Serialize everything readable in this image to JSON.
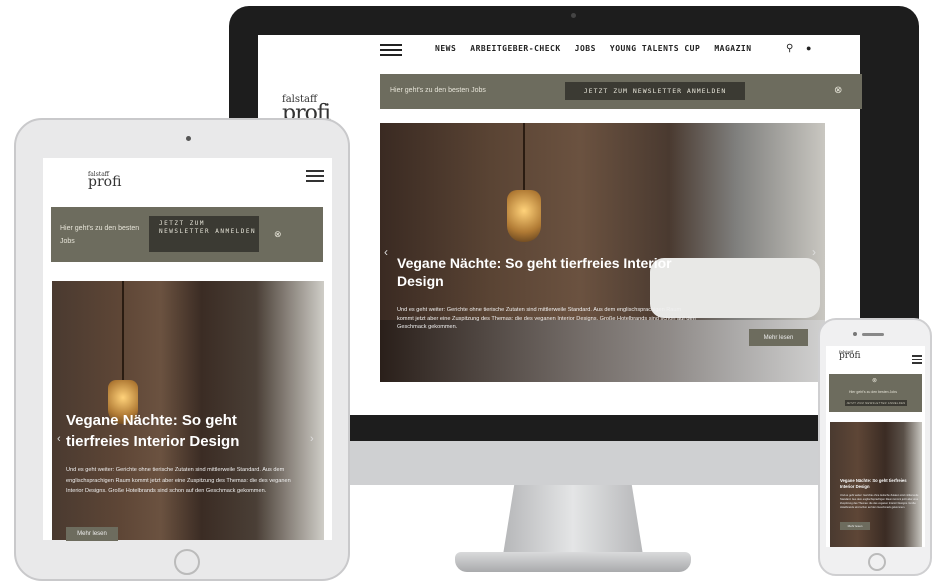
{
  "brand": {
    "logo_line1": "falstaff",
    "logo_line2": "profi"
  },
  "desktop": {
    "nav": [
      "NEWS",
      "ARBEITGEBER-CHECK",
      "JOBS",
      "YOUNG TALENTS CUP",
      "MAGAZIN"
    ],
    "search_icon": "⚲",
    "user_icon": "●",
    "band": {
      "text": "Hier geht's zu den besten Jobs",
      "button": "JETZT ZUM NEWSLETTER ANMELDEN",
      "close": "⊗"
    },
    "hero": {
      "title": "Vegane Nächte: So geht tierfreies Interior Design",
      "body": "Und es geht weiter: Gerichte ohne tierische Zutaten sind mittlerweile Standard. Aus dem englischsprachigen Raum kommt jetzt aber eine Zuspitzung des Themas: die des veganen Interior Designs. Große Hotelbrands sind schon auf den Geschmack gekommen.",
      "more": "Mehr lesen",
      "arrow_left": "‹",
      "arrow_right": "›"
    }
  },
  "tablet": {
    "band": {
      "text": "Hier geht's zu den besten Jobs",
      "button": "JETZT ZUM NEWSLETTER ANMELDEN",
      "close": "⊗"
    },
    "hero": {
      "title": "Vegane Nächte: So geht tierfreies Interior Design",
      "body": "Und es geht weiter: Gerichte ohne tierische Zutaten sind mittlerweile Standard. Aus dem englischsprachigen Raum kommt jetzt aber eine Zuspitzung des Themas: die des veganen Interior Designs. Große Hotelbrands sind schon auf den Geschmack gekommen.",
      "more": "Mehr lesen",
      "arrow_left": "‹",
      "arrow_right": "›"
    }
  },
  "phone": {
    "band": {
      "text": "Hier geht's zu den besten Jobs",
      "button": "JETZT ZUM NEWSLETTER ANMELDEN",
      "close": "⊗"
    },
    "hero": {
      "title": "Vegane Nächte: So geht tierfreies Interior Design",
      "body": "Und es geht weiter: Gerichte ohne tierische Zutaten sind mittlerweile Standard. Aus dem englischsprachigen Raum kommt jetzt aber eine Zuspitzung des Themas: die des veganen Interior Designs. Große Hotelbrands sind schon auf den Geschmack gekommen.",
      "more": "Mehr lesen"
    }
  },
  "colors": {
    "band": "#6d6c5e",
    "band_button": "#3b3a33",
    "monitor_bezel": "#1d1d1d"
  }
}
